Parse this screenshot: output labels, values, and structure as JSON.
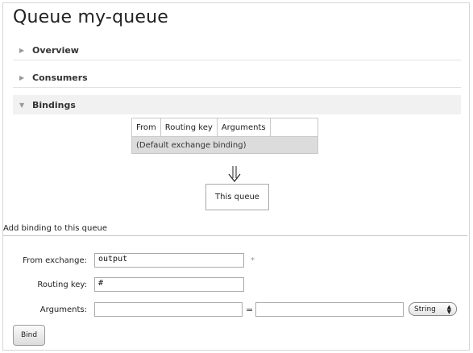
{
  "page": {
    "title": "Queue my-queue"
  },
  "sections": {
    "overview": "Overview",
    "consumers": "Consumers",
    "bindings": "Bindings"
  },
  "bindings_table": {
    "headers": [
      "From",
      "Routing key",
      "Arguments",
      ""
    ],
    "rows": [
      {
        "text": "(Default exchange binding)"
      }
    ],
    "target_label": "This queue"
  },
  "add_binding": {
    "heading": "Add binding to this queue",
    "from_exchange_label": "From exchange:",
    "from_exchange_value": "output",
    "required_marker": "*",
    "routing_key_label": "Routing key:",
    "routing_key_value": "#",
    "arguments_label": "Arguments:",
    "argument_key_value": "",
    "equals": "=",
    "argument_value": "",
    "argument_type_selected": "String",
    "bind_button": "Bind"
  }
}
